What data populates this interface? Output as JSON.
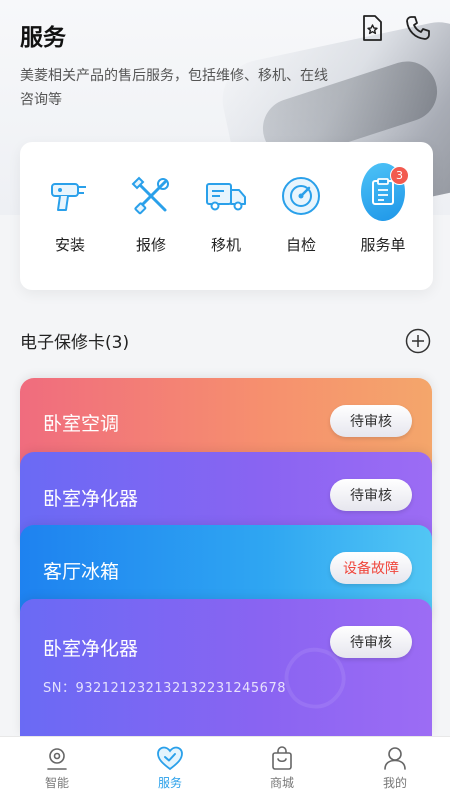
{
  "header": {
    "title": "服务",
    "subtitle": "美菱相关产品的售后服务，包括维修、移机、在线咨询等",
    "icons": [
      "favorites-icon",
      "phone-icon"
    ]
  },
  "services": [
    {
      "label": "安装",
      "icon": "drill-icon"
    },
    {
      "label": "报修",
      "icon": "tools-icon"
    },
    {
      "label": "移机",
      "icon": "truck-icon"
    },
    {
      "label": "自检",
      "icon": "selfcheck-icon"
    },
    {
      "label": "服务单",
      "icon": "order-icon",
      "badge": "3"
    }
  ],
  "warranty": {
    "title": "电子保修卡(3)",
    "cards": [
      {
        "name": "卧室空调",
        "status": "待审核"
      },
      {
        "name": "卧室净化器",
        "status": "待审核"
      },
      {
        "name": "客厅冰箱",
        "status": "设备故障"
      },
      {
        "name": "卧室净化器",
        "status": "待审核",
        "sn": "SN：932121232132132231245678"
      }
    ]
  },
  "nav": [
    {
      "label": "智能",
      "icon": "smart-icon",
      "active": false
    },
    {
      "label": "服务",
      "icon": "service-heart-icon",
      "active": true
    },
    {
      "label": "商城",
      "icon": "shopping-bag-icon",
      "active": false
    },
    {
      "label": "我的",
      "icon": "profile-icon",
      "active": false
    }
  ],
  "colors": {
    "accent": "#2aa0ea",
    "badge": "#f25a4f",
    "fault": "#f0463c"
  }
}
